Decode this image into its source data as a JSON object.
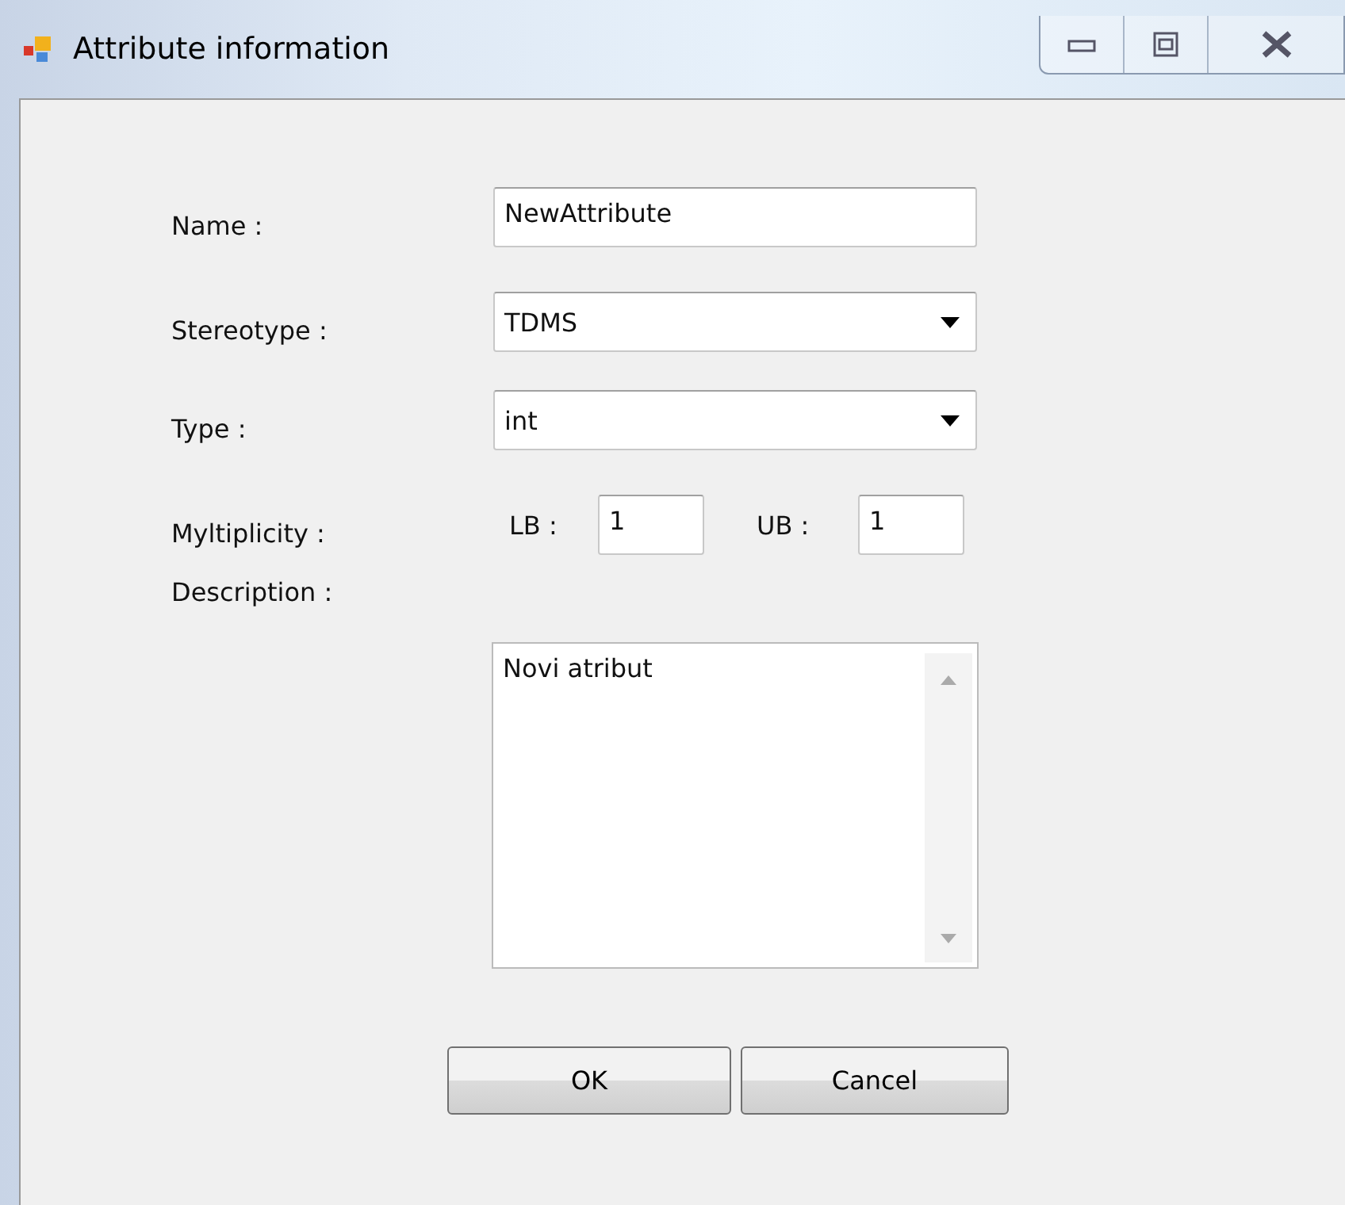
{
  "window": {
    "title": "Attribute information"
  },
  "fields": [
    {
      "label": "Name :",
      "kind": "text",
      "value": "NewAttribute"
    },
    {
      "label": "Stereotype :",
      "kind": "combo",
      "value": "TDMS"
    },
    {
      "label": "Type :",
      "kind": "combo",
      "value": "int"
    }
  ],
  "multiplicity": {
    "label": "Myltiplicity :",
    "lower_label": "LB :",
    "lower": "1",
    "upper_label": "UB :",
    "upper": "1"
  },
  "description": {
    "label": "Description :",
    "value": "Novi atribut"
  },
  "buttons": [
    "OK",
    "Cancel"
  ]
}
